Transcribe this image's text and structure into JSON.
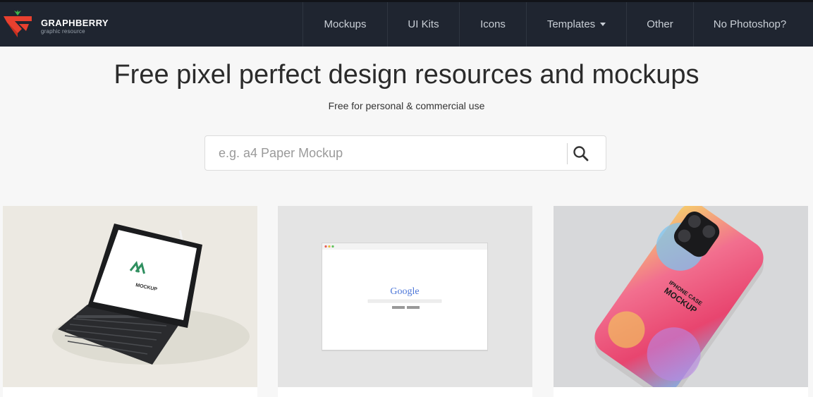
{
  "brand": {
    "name": "GRAPHBERRY",
    "tagline": "graphic resource",
    "colors": {
      "red": "#e8402f",
      "green": "#3db34a",
      "nav_bg": "#1f2530"
    }
  },
  "nav": {
    "items": [
      {
        "label": "Mockups"
      },
      {
        "label": "UI Kits"
      },
      {
        "label": "Icons"
      },
      {
        "label": "Templates",
        "has_dropdown": true
      },
      {
        "label": "Other"
      },
      {
        "label": "No Photoshop?"
      }
    ]
  },
  "hero": {
    "title": "Free pixel perfect design resources and mockups",
    "subtitle": "Free for personal & commercial use"
  },
  "search": {
    "placeholder": "e.g. a4 Paper Mockup",
    "value": "",
    "icon": "search-icon"
  },
  "cards": [
    {
      "name": "ipad-pro-keyboard-mockup",
      "screen_text": "MOCKUP"
    },
    {
      "name": "browser-window-mockup",
      "screen_text": "Google"
    },
    {
      "name": "iphone-case-mockup",
      "case_text": "IPHONE CASE",
      "case_title": "MOCKUP"
    }
  ]
}
